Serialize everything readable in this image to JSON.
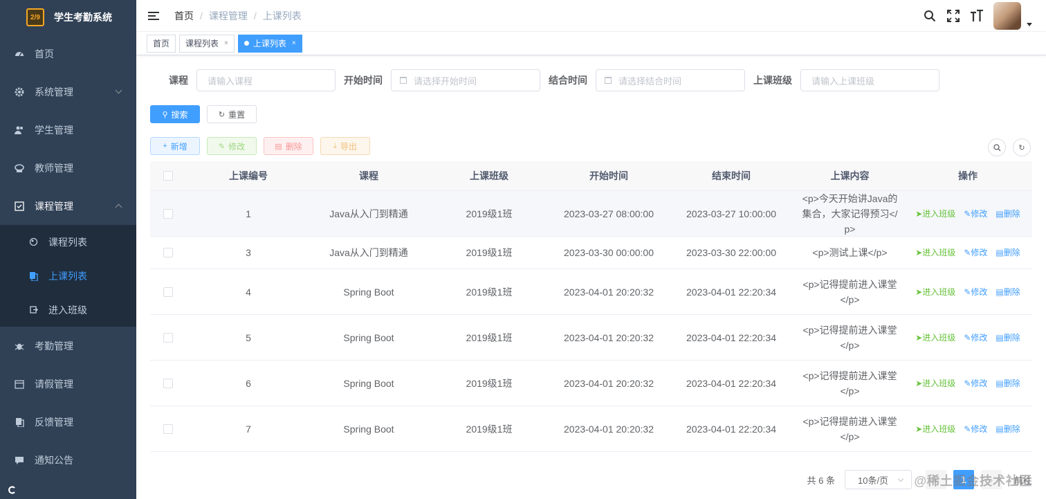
{
  "app": {
    "title": "学生考勤系统",
    "logo_text": "2/9"
  },
  "sidebar": {
    "items": [
      {
        "label": "首页",
        "icon": "dashboard-icon"
      },
      {
        "label": "系统管理",
        "icon": "gear-icon"
      },
      {
        "label": "学生管理",
        "icon": "users-icon"
      },
      {
        "label": "教师管理",
        "icon": "teacher-icon"
      },
      {
        "label": "课程管理",
        "icon": "checkbox-icon"
      }
    ],
    "course_sub": [
      {
        "label": "课程列表",
        "icon": "list-icon"
      },
      {
        "label": "上课列表",
        "icon": "copy-icon"
      },
      {
        "label": "进入班级",
        "icon": "enter-icon"
      }
    ],
    "items_after": [
      {
        "label": "考勤管理",
        "icon": "bug-icon"
      },
      {
        "label": "请假管理",
        "icon": "calendar-icon"
      },
      {
        "label": "反馈管理",
        "icon": "copy-icon"
      },
      {
        "label": "通知公告",
        "icon": "message-icon"
      }
    ]
  },
  "breadcrumb": {
    "home": "首页",
    "level1": "课程管理",
    "current": "上课列表"
  },
  "tags": {
    "home": "首页",
    "course_list": "课程列表",
    "class_list": "上课列表"
  },
  "search": {
    "course_label": "课程",
    "course_placeholder": "请输入课程",
    "start_label": "开始时间",
    "start_placeholder": "请选择开始时间",
    "end_label": "结合时间",
    "end_placeholder": "请选择结合时间",
    "class_label": "上课班级",
    "class_placeholder": "请输入上课班级",
    "search_btn": "搜索",
    "reset_btn": "重置"
  },
  "toolbar": {
    "add": "新增",
    "edit": "修改",
    "delete": "删除",
    "export": "导出"
  },
  "table": {
    "headers": [
      "上课编号",
      "课程",
      "上课班级",
      "开始时间",
      "结束时间",
      "上课内容",
      "操作"
    ],
    "rows": [
      {
        "id": "1",
        "course": "Java从入门到精通",
        "cls": "2019级1班",
        "start": "2023-03-27 08:00:00",
        "end": "2023-03-27 10:00:00",
        "content": "<p>今天开始讲Java的集合，大家记得预习</p>"
      },
      {
        "id": "3",
        "course": "Java从入门到精通",
        "cls": "2019级1班",
        "start": "2023-03-30 00:00:00",
        "end": "2023-03-30 22:00:00",
        "content": "<p>测试上课</p>"
      },
      {
        "id": "4",
        "course": "Spring Boot",
        "cls": "2019级1班",
        "start": "2023-04-01 20:20:32",
        "end": "2023-04-01 22:20:34",
        "content": "<p>记得提前进入课堂</p>"
      },
      {
        "id": "5",
        "course": "Spring Boot",
        "cls": "2019级1班",
        "start": "2023-04-01 20:20:32",
        "end": "2023-04-01 22:20:34",
        "content": "<p>记得提前进入课堂</p>"
      },
      {
        "id": "6",
        "course": "Spring Boot",
        "cls": "2019级1班",
        "start": "2023-04-01 20:20:32",
        "end": "2023-04-01 22:20:34",
        "content": "<p>记得提前进入课堂</p>"
      },
      {
        "id": "7",
        "course": "Spring Boot",
        "cls": "2019级1班",
        "start": "2023-04-01 20:20:32",
        "end": "2023-04-01 22:20:34",
        "content": "<p>记得提前进入课堂</p>"
      }
    ],
    "ops": {
      "enter": "进入班级",
      "edit": "修改",
      "delete": "删除"
    }
  },
  "pagination": {
    "total": "共 6 条",
    "page_size": "10条/页",
    "current_page": "1",
    "jump": "前往"
  },
  "watermark": "@稀土掘金技术社区",
  "colors": {
    "sidebar_bg": "#304156",
    "primary": "#409eff",
    "success": "#67c23a"
  }
}
